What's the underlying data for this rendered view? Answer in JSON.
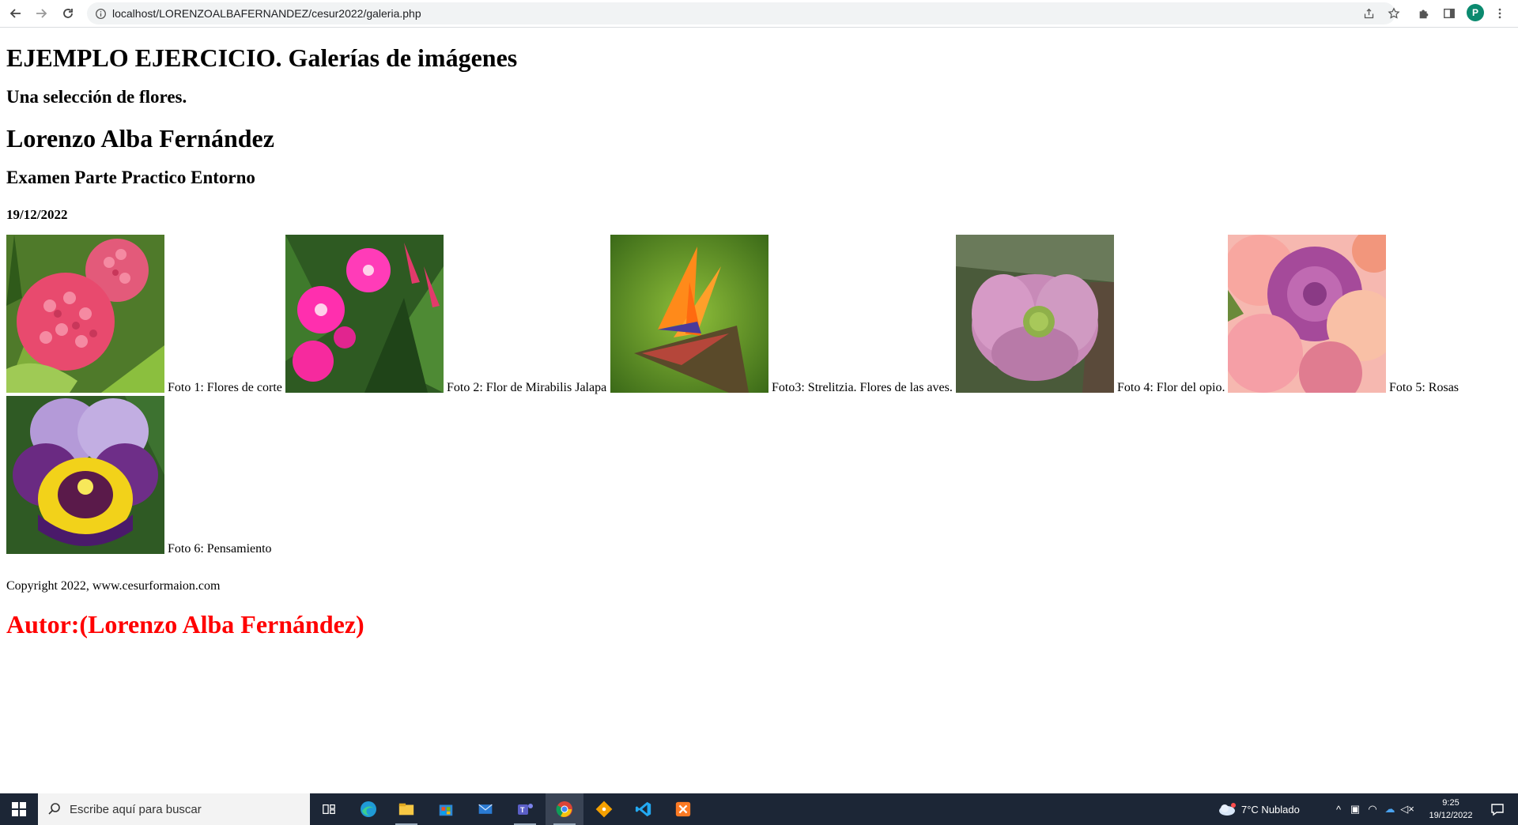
{
  "browser": {
    "url": "localhost/LORENZOALBAFERNANDEZ/cesur2022/galeria.php",
    "profile_initial": "P"
  },
  "page": {
    "title": "EJEMPLO EJERCICIO. Galerías de imágenes",
    "subtitle": "Una selección de flores.",
    "author_heading": "Lorenzo Alba Fernández",
    "exam_heading": "Examen Parte Practico Entorno",
    "date": "19/12/2022",
    "photos": [
      {
        "caption": "Foto 1: Flores de corte",
        "icon": "hydrangea-photo"
      },
      {
        "caption": "Foto 2: Flor de Mirabilis Jalapa",
        "icon": "mirabilis-photo"
      },
      {
        "caption": "Foto3: Strelitzia. Flores de las aves.",
        "icon": "strelitzia-photo"
      },
      {
        "caption": "Foto 4: Flor del opio.",
        "icon": "poppy-photo"
      },
      {
        "caption": "Foto 5: Rosas",
        "icon": "roses-photo"
      },
      {
        "caption": "Foto 6: Pensamiento",
        "icon": "pansy-photo"
      }
    ],
    "copyright": "Copyright 2022, www.cesurformaion.com",
    "autor": "Autor:(Lorenzo Alba Fernández)"
  },
  "taskbar": {
    "search_placeholder": "Escribe aquí para buscar",
    "weather": "7°C  Nublado",
    "time": "9:25",
    "date": "19/12/2022"
  },
  "colors": {
    "autor": "#ff0000",
    "taskbar": "#1c2636"
  }
}
